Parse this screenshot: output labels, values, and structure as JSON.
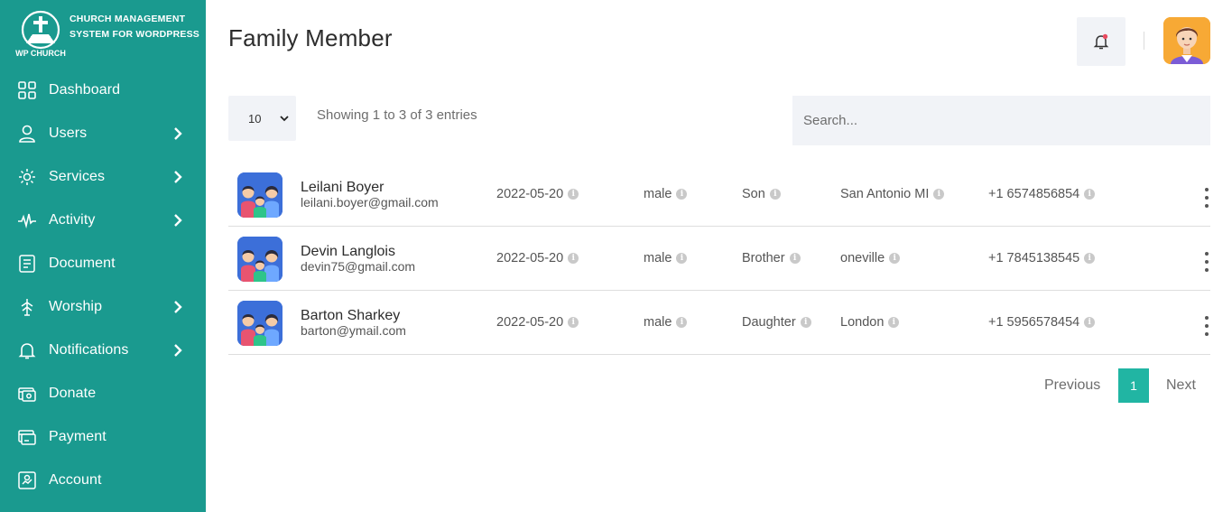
{
  "brand": {
    "logo_text": "WP CHURCH",
    "title": "CHURCH MANAGEMENT SYSTEM FOR WORDPRESS"
  },
  "sidebar": {
    "items": [
      {
        "label": "Dashboard",
        "icon": "grid-icon",
        "has_submenu": false
      },
      {
        "label": "Users",
        "icon": "user-icon",
        "has_submenu": true
      },
      {
        "label": "Services",
        "icon": "services-icon",
        "has_submenu": true
      },
      {
        "label": "Activity",
        "icon": "pulse-icon",
        "has_submenu": true
      },
      {
        "label": "Document",
        "icon": "document-icon",
        "has_submenu": false
      },
      {
        "label": "Worship",
        "icon": "worship-icon",
        "has_submenu": true
      },
      {
        "label": "Notifications",
        "icon": "bell-icon",
        "has_submenu": true
      },
      {
        "label": "Donate",
        "icon": "donate-icon",
        "has_submenu": false
      },
      {
        "label": "Payment",
        "icon": "payment-icon",
        "has_submenu": false
      },
      {
        "label": "Account",
        "icon": "account-icon",
        "has_submenu": false
      }
    ]
  },
  "header": {
    "title": "Family Member"
  },
  "table_controls": {
    "length_value": "10",
    "info": "Showing 1 to 3 of 3 entries",
    "search_placeholder": "Search..."
  },
  "rows": [
    {
      "name": "Leilani Boyer",
      "email": "leilani.boyer@gmail.com",
      "date": "2022-05-20",
      "gender": "male",
      "relation": "Son",
      "city": "San Antonio MI",
      "phone": "+1 6574856854"
    },
    {
      "name": "Devin Langlois",
      "email": "devin75@gmail.com",
      "date": "2022-05-20",
      "gender": "male",
      "relation": "Brother",
      "city": "oneville",
      "phone": "+1 7845138545"
    },
    {
      "name": "Barton Sharkey",
      "email": "barton@ymail.com",
      "date": "2022-05-20",
      "gender": "male",
      "relation": "Daughter",
      "city": "London",
      "phone": "+1 5956578454"
    }
  ],
  "pagination": {
    "previous": "Previous",
    "current": "1",
    "next": "Next"
  },
  "colors": {
    "sidebar": "#1a9a8f",
    "accent": "#21b5a3",
    "notification_dot": "#e84a5f"
  }
}
